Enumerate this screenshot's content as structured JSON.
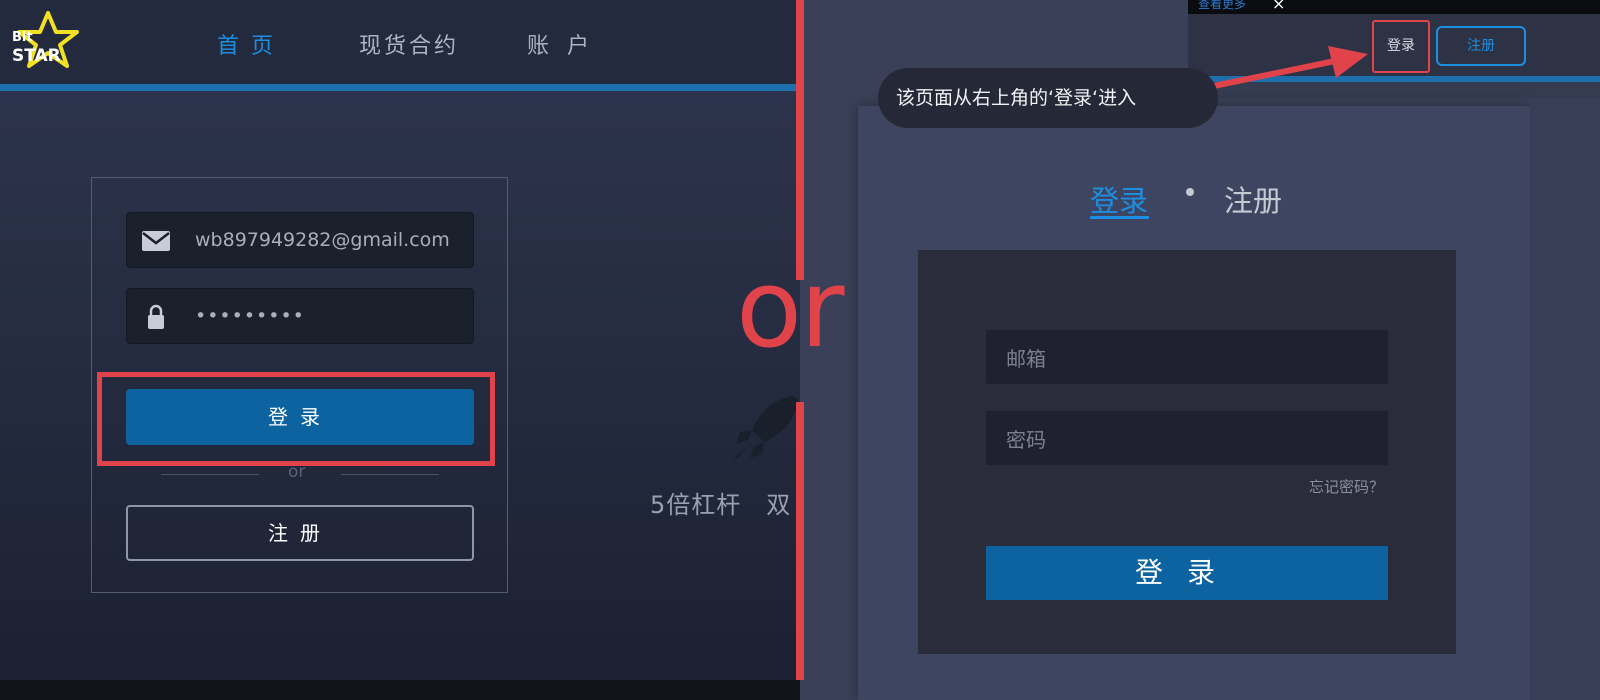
{
  "left_page": {
    "logo": {
      "line1": "Bit",
      "line2": "STAR"
    },
    "nav": {
      "home": "首页",
      "spot_contract": "现货合约",
      "account": "账户"
    },
    "login_form": {
      "email_value": "wb897949282@gmail.com",
      "password_value": "•••••••••",
      "login_button": "登录",
      "or_text": "or",
      "register_button": "注册"
    },
    "promo_text": "5倍杠杆　双"
  },
  "separator_text": "or",
  "right_page": {
    "top_strip": {
      "link": "查看更多",
      "close": "×"
    },
    "header": {
      "login_button": "登录",
      "register_button": "注册"
    },
    "tooltip": "该页面从右上角的‘登录‘进入",
    "tabs": {
      "login": "登录",
      "register": "注册"
    },
    "form": {
      "email_placeholder": "邮箱",
      "password_placeholder": "密码",
      "forgot_link": "忘记密码？",
      "login_button": "登录"
    }
  },
  "colors": {
    "accent_blue": "#1d8fe3",
    "button_blue": "#0d63a0",
    "annotation_red": "#e0434a"
  }
}
